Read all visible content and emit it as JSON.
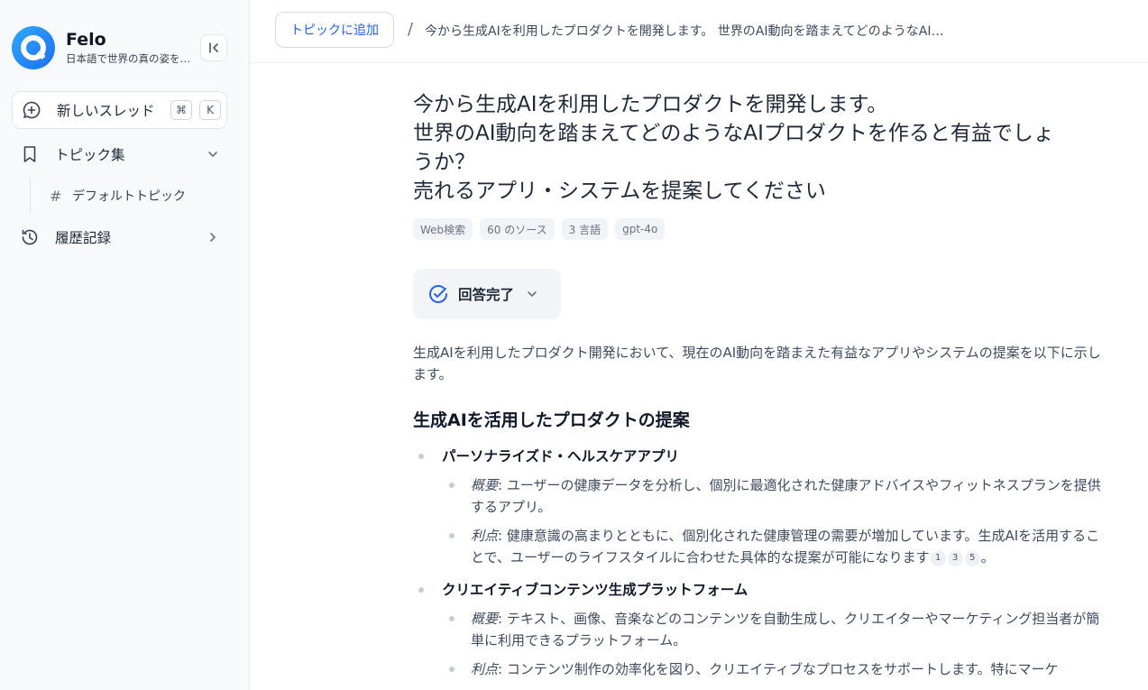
{
  "app": {
    "name": "Felo",
    "tagline": "日本語で世界の真の姿を知る"
  },
  "sidebar": {
    "new_thread": {
      "label": "新しいスレッド",
      "shortcut_mod": "⌘",
      "shortcut_key": "K"
    },
    "topics": {
      "label": "トピック集",
      "sub_items": [
        {
          "label": "デフォルトトピック"
        }
      ]
    },
    "history": {
      "label": "履歴記録"
    }
  },
  "topbar": {
    "add_topic": "トピックに追加",
    "separator": "/",
    "breadcrumb": "今から生成AIを利用したプロダクトを開発します。 世界のAI動向を踏まえてどのようなAIプロダクトを作ると有益でしょうか？ 売れるアプリ・システムを提案してください"
  },
  "question": {
    "lines": [
      "今から生成AIを利用したプロダクトを開発します。",
      "世界のAI動向を踏まえてどのようなAIプロダクトを作ると有益でしょうか？",
      "売れるアプリ・システムを提案してください"
    ]
  },
  "tags": [
    "Web検索",
    "60 のソース",
    "3 言語",
    "gpt-4o"
  ],
  "status": {
    "label": "回答完了"
  },
  "answer": {
    "intro": "生成AIを利用したプロダクト開発において、現在のAI動向を踏まえた有益なアプリやシステムの提案を以下に示します。",
    "section_title": "生成AIを活用したプロダクトの提案",
    "items": [
      {
        "title": "パーソナライズド・ヘルスケアアプリ",
        "overview_key": "概要",
        "overview": ": ユーザーの健康データを分析し、個別に最適化された健康アドバイスやフィットネスプランを提供するアプリ。",
        "benefit_key": "利点",
        "benefit": ": 健康意識の高まりとともに、個別化された健康管理の需要が増加しています。生成AIを活用することで、ユーザーのライフスタイルに合わせた具体的な提案が可能になります",
        "citations": [
          "1",
          "3",
          "5"
        ],
        "end": "。"
      },
      {
        "title": "クリエイティブコンテンツ生成プラットフォーム",
        "overview_key": "概要",
        "overview": ": テキスト、画像、音楽などのコンテンツを自動生成し、クリエイターやマーケティング担当者が簡単に利用できるプラットフォーム。",
        "benefit_key": "利点",
        "benefit": ": コンテンツ制作の効率化を図り、クリエイティブなプロセスをサポートします。特にマーケ"
      }
    ]
  }
}
